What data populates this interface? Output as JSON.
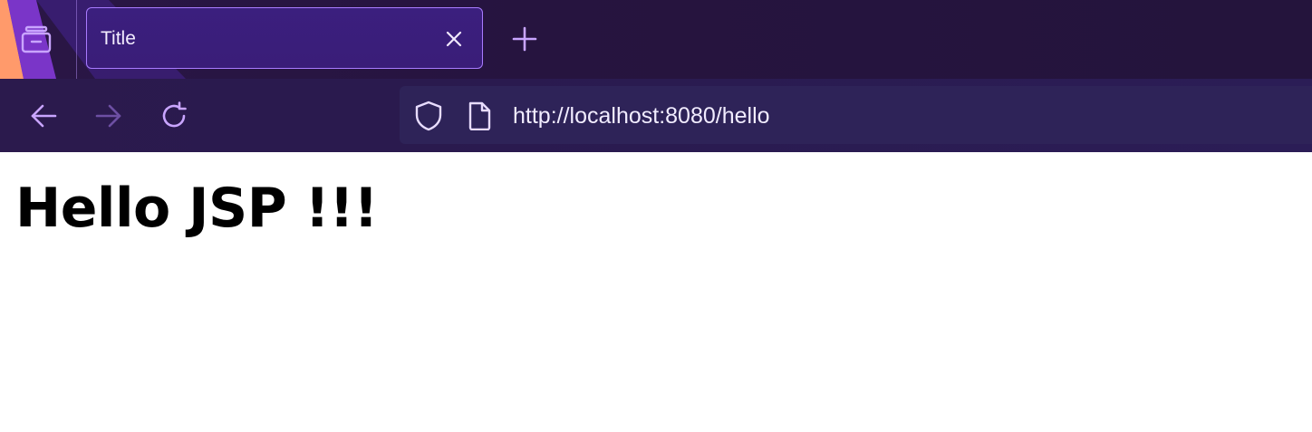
{
  "browser": {
    "tab": {
      "title": "Title"
    },
    "address_bar": {
      "url": "http://localhost:8080/hello"
    },
    "icons": {
      "tab_tray": "tab-tray-icon",
      "tab_close": "close-icon",
      "new_tab": "plus-icon",
      "back": "arrow-left-icon",
      "forward": "arrow-right-icon",
      "reload": "reload-icon",
      "site_security": "shield-icon",
      "page": "page-icon"
    },
    "state": {
      "forward_enabled": false
    },
    "colors": {
      "accent": "#a97bff",
      "tab_background": "#3b1f7e",
      "toolbar_background": "#2a1a4e",
      "url_bar_background": "#2e2358"
    }
  },
  "page": {
    "heading": "Hello JSP !!!"
  }
}
